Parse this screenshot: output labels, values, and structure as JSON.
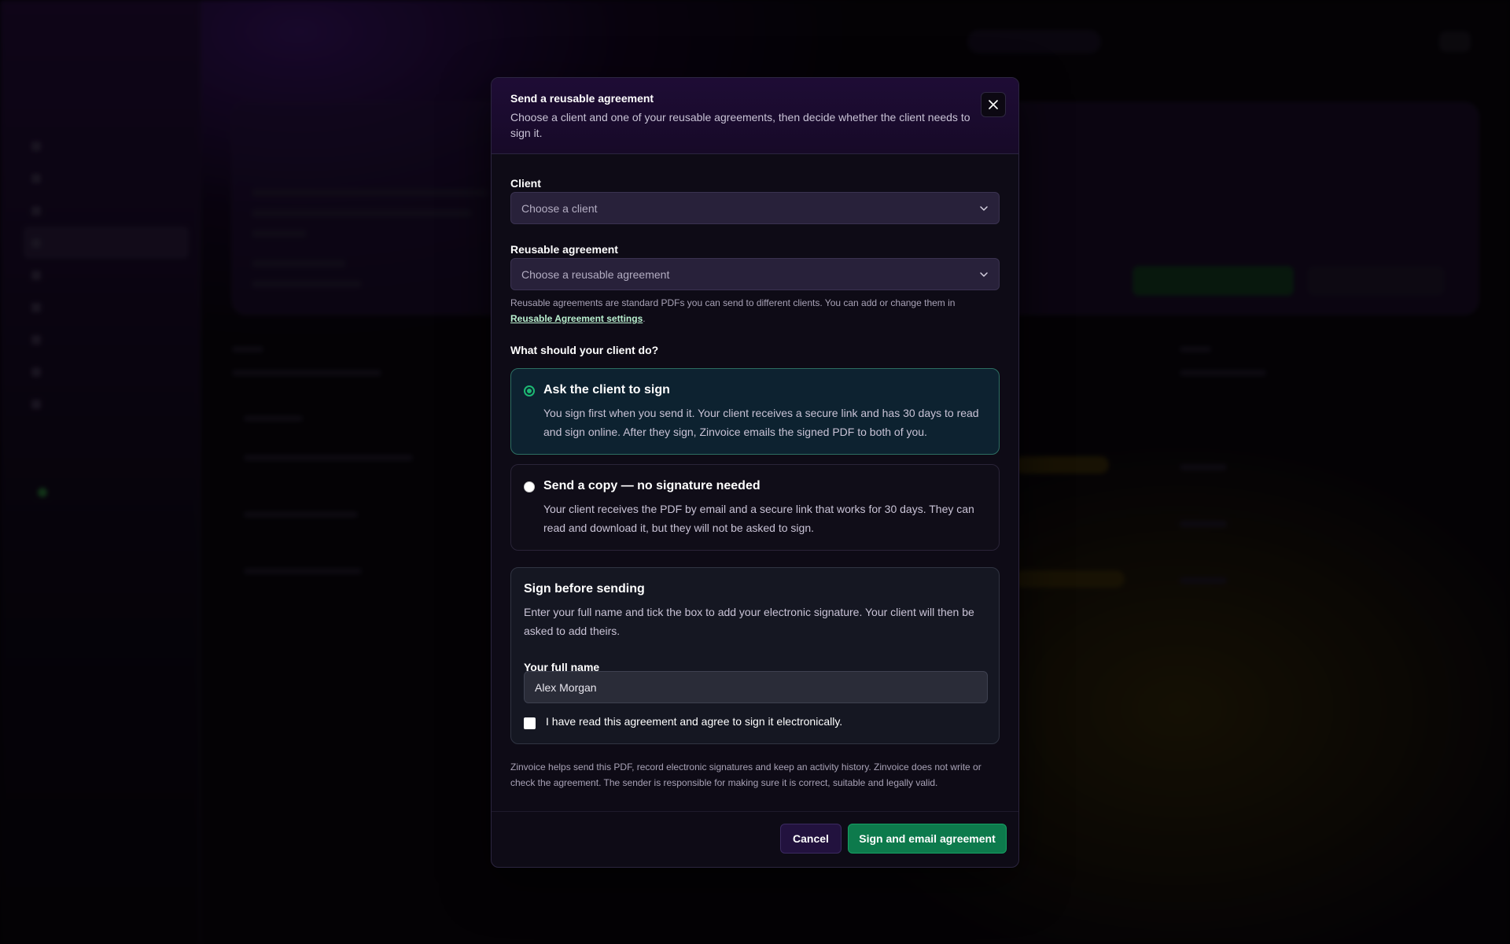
{
  "modal": {
    "title": "Send a reusable agreement",
    "subtitle": "Choose a client and one of your reusable agreements, then decide whether the client needs to sign it.",
    "close_icon": "close-icon"
  },
  "client_field": {
    "label": "Client",
    "placeholder": "Choose a client"
  },
  "agreement_field": {
    "label": "Reusable agreement",
    "placeholder": "Choose a reusable agreement",
    "help_prefix": "Reusable agreements are standard PDFs you can send to different clients. You can add or change them in ",
    "help_link": "Reusable Agreement settings",
    "help_suffix": "."
  },
  "question": "What should your client do?",
  "options": [
    {
      "title": "Ask the client to sign",
      "description": "You sign first when you send it. Your client receives a secure link and has 30 days to read and sign online. After they sign, Zinvoice emails the signed PDF to both of you.",
      "selected": true
    },
    {
      "title": "Send a copy — no signature needed",
      "description": "Your client receives the PDF by email and a secure link that works for 30 days. They can read and download it, but they will not be asked to sign.",
      "selected": false
    }
  ],
  "sign_section": {
    "title": "Sign before sending",
    "description": "Enter your full name and tick the box to add your electronic signature. Your client will then be asked to add theirs.",
    "name_label": "Your full name",
    "name_value": "Alex Morgan",
    "checkbox_label": "I have read this agreement and agree to sign it electronically.",
    "checked": false
  },
  "disclaimer": "Zinvoice helps send this PDF, record electronic signatures and keep an activity history. Zinvoice does not write or check the agreement. The sender is responsible for making sure it is correct, suitable and legally valid.",
  "footer": {
    "cancel_label": "Cancel",
    "submit_label": "Sign and email agreement"
  },
  "colors": {
    "accent_green": "#0d7a4c",
    "radio_green": "#1db873",
    "link_green": "#b9f0cf",
    "header_purple": "#1e0c35"
  }
}
